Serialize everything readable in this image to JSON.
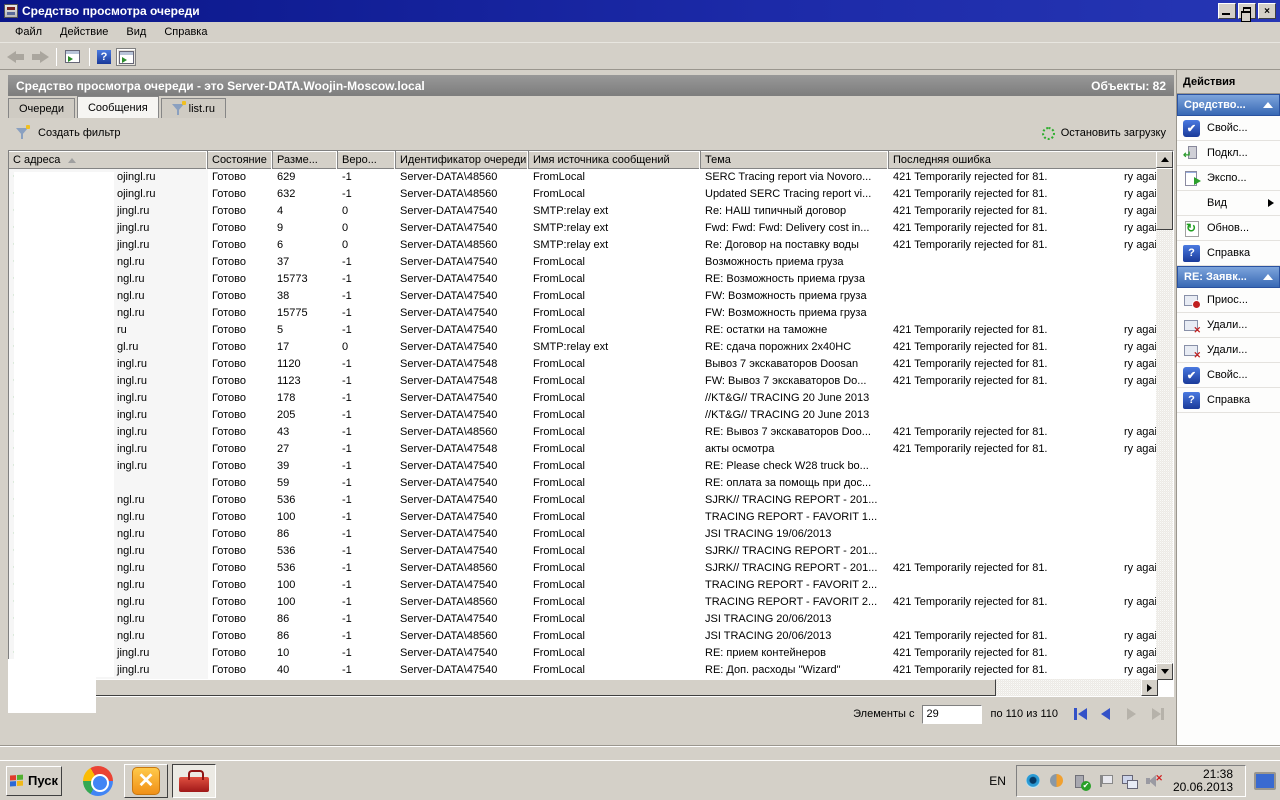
{
  "window": {
    "title": "Средство просмотра очереди",
    "objects_label": "Объекты:  82"
  },
  "menu": {
    "items": [
      "Файл",
      "Действие",
      "Вид",
      "Справка"
    ]
  },
  "result_header": {
    "title": "Средство просмотра очереди - это Server-DATA.Woojin-Moscow.local"
  },
  "tabs": [
    {
      "label": "Очереди",
      "active": false,
      "icon": ""
    },
    {
      "label": "Сообщения",
      "active": true,
      "icon": ""
    },
    {
      "label": "list.ru",
      "active": false,
      "icon": "filter-icon"
    }
  ],
  "filter_bar": {
    "create_filter": "Создать фильтр",
    "stop_loading": "Остановить загрузку"
  },
  "table": {
    "columns": [
      "С адреса",
      "Состояние",
      "Разме...",
      "Веро...",
      "Идентификатор очереди",
      "Имя источника сообщений",
      "Тема",
      "Последняя ошибка"
    ],
    "sorted_column": 0,
    "rows": [
      {
        "from": "ojingl.ru",
        "status": "Готово",
        "size": "629",
        "prob": "-1",
        "queue": "Server-DATA\\48560",
        "source": "FromLocal",
        "subject": "SERC Tracing report via Novoro...",
        "error": "421 Temporarily rejected for 81.",
        "error_tail": "ry agai"
      },
      {
        "from": "ojingl.ru",
        "status": "Готово",
        "size": "632",
        "prob": "-1",
        "queue": "Server-DATA\\48560",
        "source": "FromLocal",
        "subject": "Updated SERC Tracing report vi...",
        "error": "421 Temporarily rejected for 81.",
        "error_tail": "ry agai"
      },
      {
        "from": "jingl.ru",
        "status": "Готово",
        "size": "4",
        "prob": "0",
        "queue": "Server-DATA\\47540",
        "source": "SMTP:relay ext",
        "subject": "Re: НАШ типичный договор",
        "error": "421 Temporarily rejected for 81.",
        "error_tail": "ry agai"
      },
      {
        "from": "jingl.ru",
        "status": "Готово",
        "size": "9",
        "prob": "0",
        "queue": "Server-DATA\\47540",
        "source": "SMTP:relay ext",
        "subject": "Fwd: Fwd: Fwd: Delivery cost in...",
        "error": "421 Temporarily rejected for 81.",
        "error_tail": "ry agai"
      },
      {
        "from": "jingl.ru",
        "status": "Готово",
        "size": "6",
        "prob": "0",
        "queue": "Server-DATA\\48560",
        "source": "SMTP:relay ext",
        "subject": "Re: Договор на поставку воды",
        "error": "421 Temporarily rejected for 81.",
        "error_tail": "ry agai"
      },
      {
        "from": "ngl.ru",
        "status": "Готово",
        "size": "37",
        "prob": "-1",
        "queue": "Server-DATA\\47540",
        "source": "FromLocal",
        "subject": "Возможность приема груза",
        "error": "",
        "error_tail": ""
      },
      {
        "from": "ngl.ru",
        "status": "Готово",
        "size": "15773",
        "prob": "-1",
        "queue": "Server-DATA\\47540",
        "source": "FromLocal",
        "subject": "RE: Возможность приема груза",
        "error": "",
        "error_tail": ""
      },
      {
        "from": "ngl.ru",
        "status": "Готово",
        "size": "38",
        "prob": "-1",
        "queue": "Server-DATA\\47540",
        "source": "FromLocal",
        "subject": "FW: Возможность приема груза",
        "error": "",
        "error_tail": ""
      },
      {
        "from": "ngl.ru",
        "status": "Готово",
        "size": "15775",
        "prob": "-1",
        "queue": "Server-DATA\\47540",
        "source": "FromLocal",
        "subject": "FW: Возможность приема груза",
        "error": "",
        "error_tail": ""
      },
      {
        "from": "ru",
        "status": "Готово",
        "size": "5",
        "prob": "-1",
        "queue": "Server-DATA\\47540",
        "source": "FromLocal",
        "subject": "RE: остатки на таможне",
        "error": "421 Temporarily rejected for 81.",
        "error_tail": "ry agai"
      },
      {
        "from": "gl.ru",
        "status": "Готово",
        "size": "17",
        "prob": "0",
        "queue": "Server-DATA\\47540",
        "source": "SMTP:relay ext",
        "subject": "RE: сдача порожних 2x40HC",
        "error": "421 Temporarily rejected for 81.",
        "error_tail": "ry agai"
      },
      {
        "from": "ingl.ru",
        "status": "Готово",
        "size": "1120",
        "prob": "-1",
        "queue": "Server-DATA\\47548",
        "source": "FromLocal",
        "subject": "Вывоз 7 экскаваторов Doosan",
        "error": "421 Temporarily rejected for 81.",
        "error_tail": "ry agai"
      },
      {
        "from": "ingl.ru",
        "status": "Готово",
        "size": "1123",
        "prob": "-1",
        "queue": "Server-DATA\\47548",
        "source": "FromLocal",
        "subject": "FW: Вывоз 7 экскаваторов Do...",
        "error": "421 Temporarily rejected for 81.",
        "error_tail": "ry agai"
      },
      {
        "from": "ingl.ru",
        "status": "Готово",
        "size": "178",
        "prob": "-1",
        "queue": "Server-DATA\\47540",
        "source": "FromLocal",
        "subject": "//KT&G// TRACING 20 June 2013",
        "error": "",
        "error_tail": ""
      },
      {
        "from": "ingl.ru",
        "status": "Готово",
        "size": "205",
        "prob": "-1",
        "queue": "Server-DATA\\47540",
        "source": "FromLocal",
        "subject": "//KT&G// TRACING 20 June 2013",
        "error": "",
        "error_tail": ""
      },
      {
        "from": "ingl.ru",
        "status": "Готово",
        "size": "43",
        "prob": "-1",
        "queue": "Server-DATA\\48560",
        "source": "FromLocal",
        "subject": "RE: Вывоз 7 экскаваторов Doo...",
        "error": "421 Temporarily rejected for 81.",
        "error_tail": "ry agai"
      },
      {
        "from": "ingl.ru",
        "status": "Готово",
        "size": "27",
        "prob": "-1",
        "queue": "Server-DATA\\47548",
        "source": "FromLocal",
        "subject": "акты осмотра",
        "error": "421 Temporarily rejected for 81.",
        "error_tail": "ry agai"
      },
      {
        "from": "ingl.ru",
        "status": "Готово",
        "size": "39",
        "prob": "-1",
        "queue": "Server-DATA\\47540",
        "source": "FromLocal",
        "subject": "RE: Please check  W28 truck bo...",
        "error": "",
        "error_tail": ""
      },
      {
        "from": "",
        "status": "Готово",
        "size": "59",
        "prob": "-1",
        "queue": "Server-DATA\\47540",
        "source": "FromLocal",
        "subject": "RE: оплата за помощь при дос...",
        "error": "",
        "error_tail": ""
      },
      {
        "from": "ngl.ru",
        "status": "Готово",
        "size": "536",
        "prob": "-1",
        "queue": "Server-DATA\\47540",
        "source": "FromLocal",
        "subject": "SJRK// TRACING REPORT - 201...",
        "error": "",
        "error_tail": ""
      },
      {
        "from": "ngl.ru",
        "status": "Готово",
        "size": "100",
        "prob": "-1",
        "queue": "Server-DATA\\47540",
        "source": "FromLocal",
        "subject": "TRACING REPORT - FAVORIT 1...",
        "error": "",
        "error_tail": ""
      },
      {
        "from": "ngl.ru",
        "status": "Готово",
        "size": "86",
        "prob": "-1",
        "queue": "Server-DATA\\47540",
        "source": "FromLocal",
        "subject": "JSI TRACING  19/06/2013",
        "error": "",
        "error_tail": ""
      },
      {
        "from": "ngl.ru",
        "status": "Готово",
        "size": "536",
        "prob": "-1",
        "queue": "Server-DATA\\47540",
        "source": "FromLocal",
        "subject": "SJRK// TRACING REPORT - 201...",
        "error": "",
        "error_tail": ""
      },
      {
        "from": "ngl.ru",
        "status": "Готово",
        "size": "536",
        "prob": "-1",
        "queue": "Server-DATA\\48560",
        "source": "FromLocal",
        "subject": "SJRK// TRACING REPORT - 201...",
        "error": "421 Temporarily rejected for 81.",
        "error_tail": "ry agai"
      },
      {
        "from": "ngl.ru",
        "status": "Готово",
        "size": "100",
        "prob": "-1",
        "queue": "Server-DATA\\47540",
        "source": "FromLocal",
        "subject": "TRACING REPORT - FAVORIT 2...",
        "error": "",
        "error_tail": ""
      },
      {
        "from": "ngl.ru",
        "status": "Готово",
        "size": "100",
        "prob": "-1",
        "queue": "Server-DATA\\48560",
        "source": "FromLocal",
        "subject": "TRACING REPORT - FAVORIT 2...",
        "error": "421 Temporarily rejected for 81.",
        "error_tail": "ry agai"
      },
      {
        "from": "ngl.ru",
        "status": "Готово",
        "size": "86",
        "prob": "-1",
        "queue": "Server-DATA\\47540",
        "source": "FromLocal",
        "subject": "JSI TRACING  20/06/2013",
        "error": "",
        "error_tail": ""
      },
      {
        "from": "ngl.ru",
        "status": "Готово",
        "size": "86",
        "prob": "-1",
        "queue": "Server-DATA\\48560",
        "source": "FromLocal",
        "subject": "JSI TRACING 20/06/2013",
        "error": "421 Temporarily rejected for 81.",
        "error_tail": "ry agai"
      },
      {
        "from": "jingl.ru",
        "status": "Готово",
        "size": "10",
        "prob": "-1",
        "queue": "Server-DATA\\47540",
        "source": "FromLocal",
        "subject": "RE: прием контейнеров",
        "error": "421 Temporarily rejected for 81.",
        "error_tail": "ry agai"
      },
      {
        "from": "jingl.ru",
        "status": "Готово",
        "size": "40",
        "prob": "-1",
        "queue": "Server-DATA\\47540",
        "source": "FromLocal",
        "subject": "RE: Доп. расходы \"Wizard\"",
        "error": "421 Temporarily rejected for 81.",
        "error_tail": "ry agai"
      }
    ]
  },
  "pagination": {
    "items_from_label": "Элементы с",
    "input_value": "29",
    "range_label": "по 110 из 110"
  },
  "actions_panel": {
    "title": "Действия",
    "groups": [
      {
        "header": "Средство...",
        "items": [
          {
            "label": "Свойс...",
            "icon": "properties-icon"
          },
          {
            "label": "Подкл...",
            "icon": "connect-icon"
          },
          {
            "label": "Экспо...",
            "icon": "export-icon"
          },
          {
            "label": "Вид",
            "icon": "none",
            "submenu": true
          },
          {
            "label": "Обнов...",
            "icon": "refresh-icon"
          },
          {
            "label": "Справка",
            "icon": "help-icon"
          }
        ]
      },
      {
        "header": "RE: Заявк...",
        "items": [
          {
            "label": "Приос...",
            "icon": "suspend-message-icon"
          },
          {
            "label": "Удали...",
            "icon": "delete-message-icon"
          },
          {
            "label": "Удали...",
            "icon": "delete-message-icon"
          },
          {
            "label": "Свойс...",
            "icon": "properties-icon"
          },
          {
            "label": "Справка",
            "icon": "help-icon"
          }
        ]
      }
    ]
  },
  "taskbar": {
    "start_label": "Пуск",
    "language": "EN",
    "time": "21:38",
    "date": "20.06.2013"
  }
}
